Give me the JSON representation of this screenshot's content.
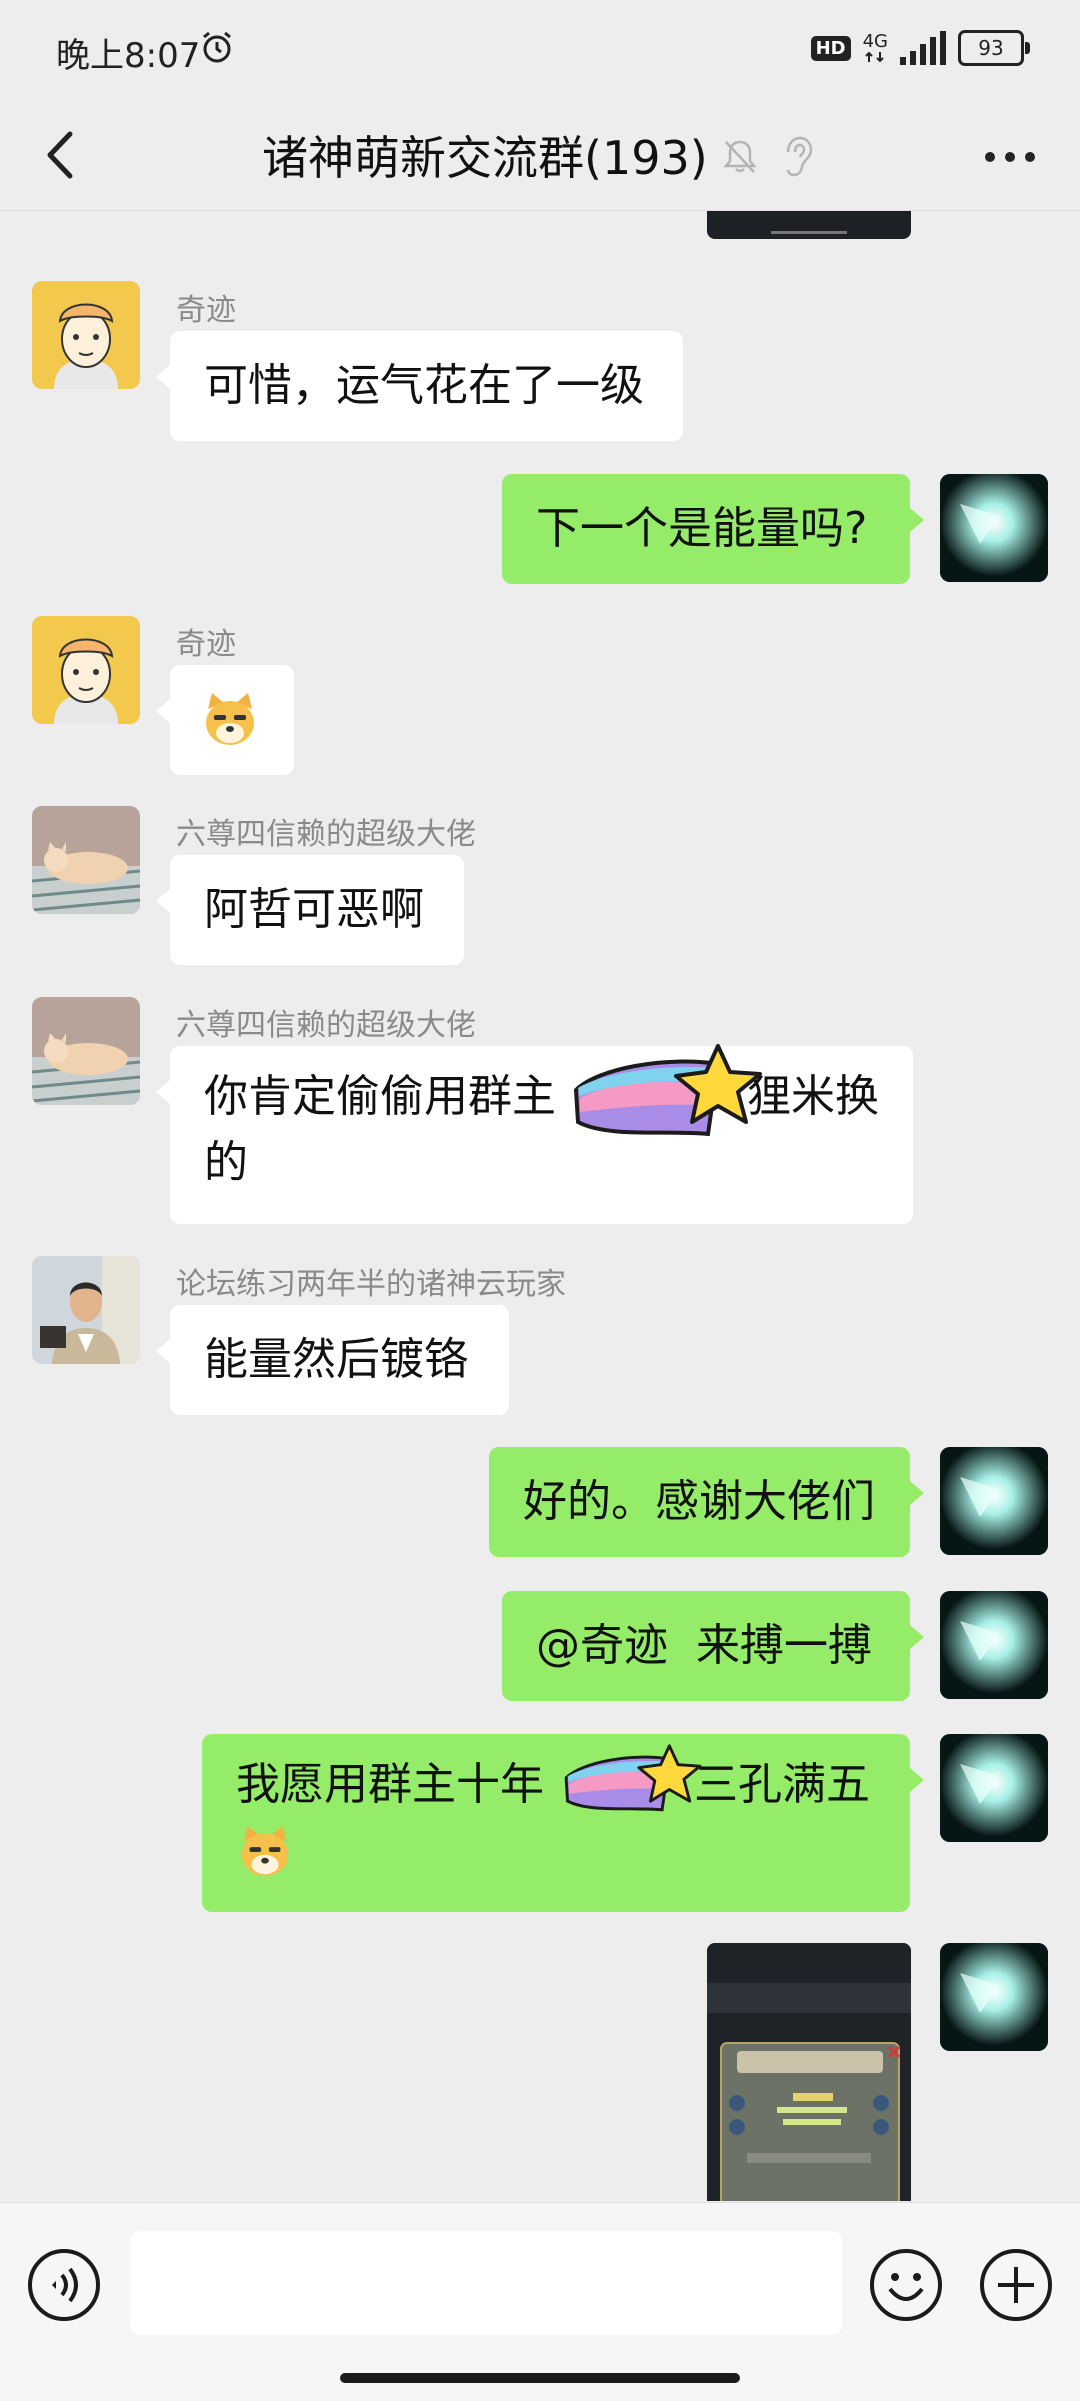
{
  "status_bar": {
    "time": "晚上8:07",
    "hd": "HD",
    "network": "4G",
    "battery": "93"
  },
  "header": {
    "title": "诸神萌新交流群(193)"
  },
  "messages": [
    {
      "sender": "奇迹",
      "text": "可惜，运气花在了一级"
    },
    {
      "text": "下一个是能量吗?"
    },
    {
      "sender": "奇迹"
    },
    {
      "sender": "六尊四信赖的超级大佬",
      "text": "阿哲可恶啊"
    },
    {
      "sender": "六尊四信赖的超级大佬",
      "line1_a": "你肯定偷偷用群主",
      "line1_b": "狸米换",
      "line2": "的"
    },
    {
      "sender": "论坛练习两年半的诸神云玩家",
      "text": "能量然后镀铬"
    },
    {
      "text": "好的。感谢大佬们"
    },
    {
      "text": "@奇迹  来搏一搏"
    },
    {
      "line1_a": "我愿用群主十年",
      "line1_b": "三孔满五"
    }
  ],
  "colors": {
    "background": "#ededed",
    "bubble_out": "#95ec69",
    "bubble_in": "#ffffff"
  },
  "input": {
    "placeholder": ""
  }
}
